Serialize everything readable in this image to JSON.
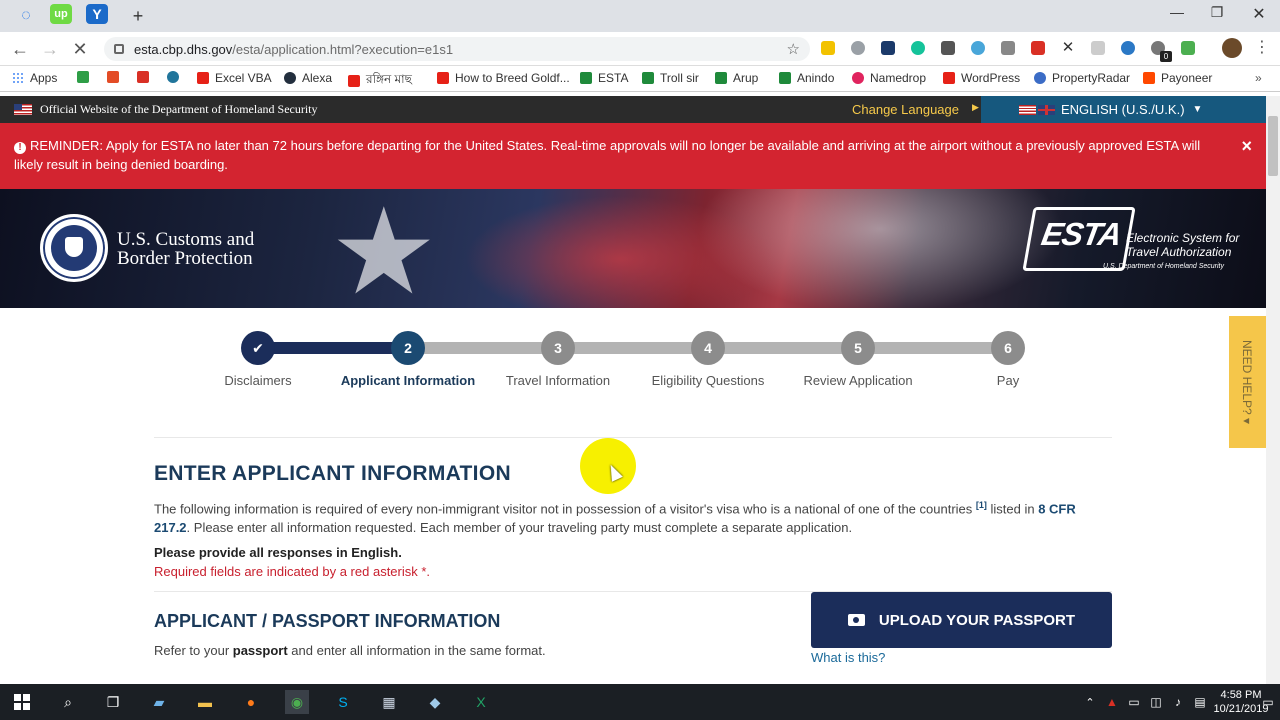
{
  "browser": {
    "url_host": "esta.cbp.dhs.gov",
    "url_path": "/esta/application.html?execution=e1s1",
    "new_tab": "+",
    "tabs": [
      "up"
    ],
    "ext_badge": "0",
    "bookmarks": [
      {
        "label": "Apps",
        "color": "#4285f4"
      },
      {
        "label": "",
        "color": "#2e9e47"
      },
      {
        "label": "",
        "color": "#e34c26"
      },
      {
        "label": "",
        "color": "#d93025"
      },
      {
        "label": "",
        "color": "#21759b"
      },
      {
        "label": "Excel VBA",
        "color": "#e62117"
      },
      {
        "label": "Alexa",
        "color": "#232f3e"
      },
      {
        "label": "রঙ্গিন মাছ",
        "color": "#e62117"
      },
      {
        "label": "How to Breed Goldf...",
        "color": "#e62117"
      },
      {
        "label": "ESTA",
        "color": "#1f8a3b"
      },
      {
        "label": "Troll sir",
        "color": "#1f8a3b"
      },
      {
        "label": "Arup",
        "color": "#1f8a3b"
      },
      {
        "label": "Anindo",
        "color": "#1f8a3b"
      },
      {
        "label": "Namedrop",
        "color": "#e0245e"
      },
      {
        "label": "WordPress",
        "color": "#e62117"
      },
      {
        "label": "PropertyRadar",
        "color": "#3b6cc6"
      },
      {
        "label": "Payoneer",
        "color": "#ff4800"
      }
    ]
  },
  "dhs_bar": {
    "label": "Official Website of the Department of Homeland Security",
    "change_language": "Change Language",
    "language": "ENGLISH (U.S./U.K.)"
  },
  "reminder": {
    "text": "REMINDER: Apply for ESTA no later than 72 hours before departing for the United States. Real-time approvals will no longer be available and arriving at the airport without a previously approved ESTA will likely result in being denied boarding.",
    "close": "×"
  },
  "header": {
    "cbp_line1": "U.S. Customs and",
    "cbp_line2": "Border Protection",
    "esta": "ESTA",
    "esta_sub1": "Electronic System for",
    "esta_sub2": "Travel Authorization",
    "esta_dept": "U.S. Department of Homeland Security"
  },
  "steps": [
    {
      "num": "✔",
      "label": "Disclaimers",
      "state": "done"
    },
    {
      "num": "2",
      "label": "Applicant Information",
      "state": "current"
    },
    {
      "num": "3",
      "label": "Travel Information",
      "state": "todo"
    },
    {
      "num": "4",
      "label": "Eligibility Questions",
      "state": "todo"
    },
    {
      "num": "5",
      "label": "Review Application",
      "state": "todo"
    },
    {
      "num": "6",
      "label": "Pay",
      "state": "todo"
    }
  ],
  "need_help": "NEED HELP? ▾",
  "main": {
    "title": "ENTER APPLICANT INFORMATION",
    "intro_1": "The following information is required of every non-immigrant visitor not in possession of a visitor's visa who is a national of one of the countries ",
    "intro_sup": "[1]",
    "intro_2": " listed in ",
    "intro_link": "8 CFR 217.2",
    "intro_3": ". Please enter all information requested. Each member of your traveling party must complete a separate application.",
    "english_note": "Please provide all responses in English.",
    "required_note": "Required fields are indicated by a red asterisk *.",
    "section_title": "APPLICANT / PASSPORT INFORMATION",
    "section_sub_1": "Refer to your ",
    "section_sub_bold": "passport",
    "section_sub_2": " and enter all information in the same format.",
    "upload_label": "UPLOAD YOUR PASSPORT",
    "what_is_this": "What is this?"
  },
  "taskbar": {
    "time": "4:58 PM",
    "date": "10/21/2019"
  }
}
